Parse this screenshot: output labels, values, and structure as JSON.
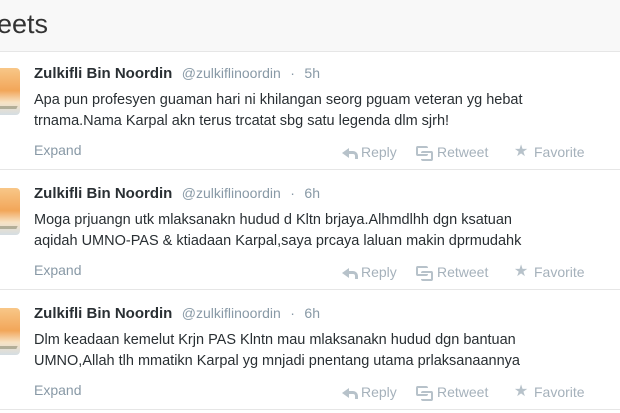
{
  "header": {
    "title": "eets"
  },
  "tweets": [
    {
      "display_name": "Zulkifli Bin Noordin",
      "username": "@zulkiflinoordin",
      "separator": "·",
      "time": "5h",
      "text_lines": [
        "Apa pun profesyen guaman hari ni khilangan seorg pguam veteran yg hebat",
        "trnama.Nama Karpal akn terus trcatat sbg satu legenda dlm sjrh!"
      ],
      "expand_label": "Expand",
      "actions": {
        "reply": "Reply",
        "retweet": "Retweet",
        "favorite": "Favorite"
      },
      "avatar_icon": "profile-avatar"
    },
    {
      "display_name": "Zulkifli Bin Noordin",
      "username": "@zulkiflinoordin",
      "separator": "·",
      "time": "6h",
      "text_lines": [
        "Moga prjuangn utk mlaksanakn hudud d Kltn brjaya.Alhmdlhh dgn ksatuan",
        "aqidah UMNO-PAS & ktiadaan Karpal,saya prcaya laluan makin dprmudahk"
      ],
      "expand_label": "Expand",
      "actions": {
        "reply": "Reply",
        "retweet": "Retweet",
        "favorite": "Favorite"
      },
      "avatar_icon": "profile-avatar"
    },
    {
      "display_name": "Zulkifli Bin Noordin",
      "username": "@zulkiflinoordin",
      "separator": "·",
      "time": "6h",
      "text_lines": [
        "Dlm keadaan kemelut Krjn PAS Klntn mau mlaksanakn hudud dgn bantuan",
        "UMNO,Allah tlh mmatikn Karpal yg mnjadi pnentang utama prlaksanaannya"
      ],
      "expand_label": "Expand",
      "actions": {
        "reply": "Reply",
        "retweet": "Retweet",
        "favorite": "Favorite"
      },
      "avatar_icon": "profile-avatar"
    }
  ],
  "colors": {
    "text": "#292f33",
    "muted": "#8899a6",
    "action": "#a5b1bb",
    "border": "#e6e6e6",
    "header_background": "#f8f8f8"
  }
}
